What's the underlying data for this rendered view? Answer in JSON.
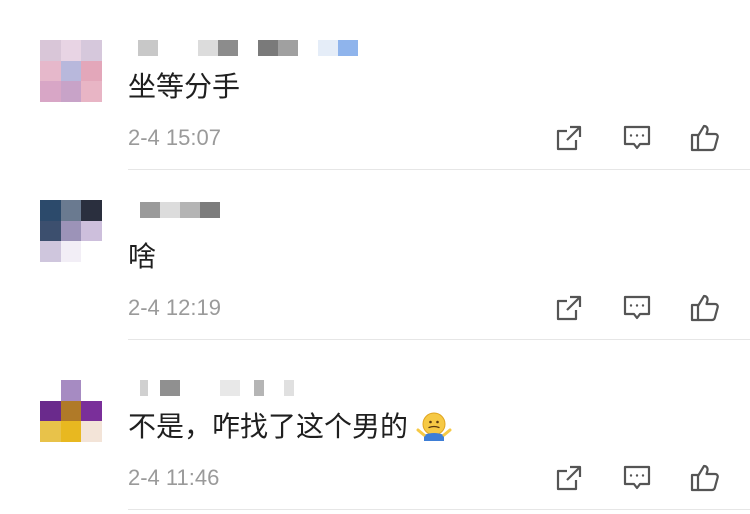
{
  "comments": [
    {
      "text": "坐等分手",
      "time": "2-4 15:07",
      "has_emoji": false
    },
    {
      "text": "啥",
      "time": "2-4 12:19",
      "has_emoji": false
    },
    {
      "text": "不是，咋找了这个男的",
      "time": "2-4 11:46",
      "has_emoji": true,
      "emoji_icon": "shrug-emoji-icon"
    }
  ],
  "icons": {
    "share": "share-icon",
    "reply": "comment-icon",
    "like": "thumbs-up-icon"
  },
  "colors": {
    "text": "#1f1f1f",
    "timestamp": "#9a9a9a",
    "icon": "#555555",
    "divider": "#e6e6e6"
  }
}
